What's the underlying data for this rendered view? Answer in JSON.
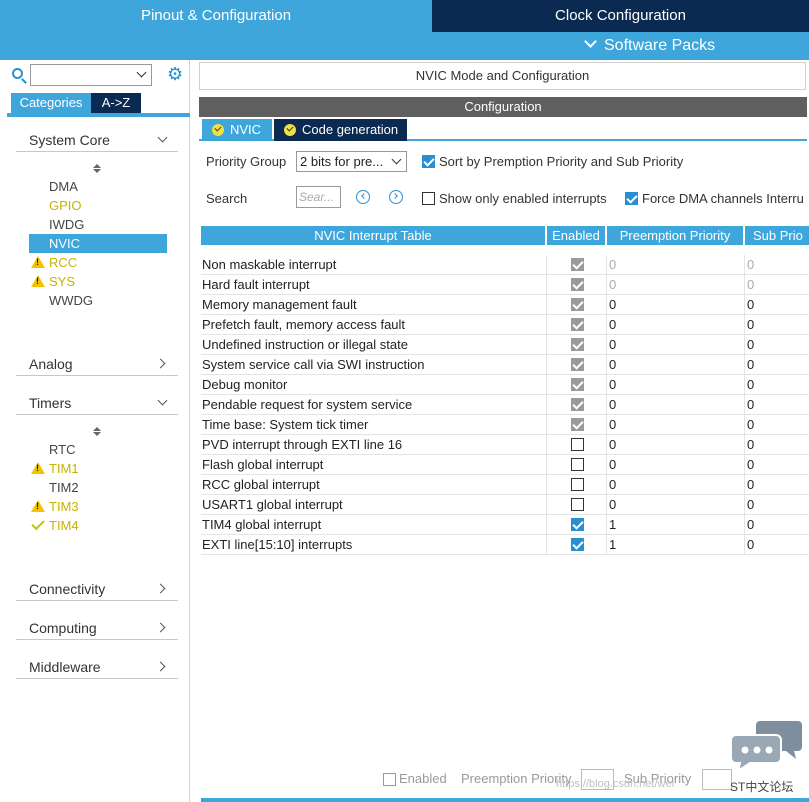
{
  "top_tabs": {
    "pinout": "Pinout & Configuration",
    "clock": "Clock Configuration",
    "software_packs": "Software Packs"
  },
  "left_panel": {
    "search_value": "",
    "tab_categories": "Categories",
    "tab_az": "A->Z",
    "system_core": {
      "title": "System Core",
      "items": [
        {
          "label": "DMA",
          "state": "normal"
        },
        {
          "label": "GPIO",
          "state": "configured"
        },
        {
          "label": "IWDG",
          "state": "normal"
        },
        {
          "label": "NVIC",
          "state": "selected"
        },
        {
          "label": "RCC",
          "state": "warning"
        },
        {
          "label": "SYS",
          "state": "warning"
        },
        {
          "label": "WWDG",
          "state": "normal"
        }
      ]
    },
    "analog": "Analog",
    "timers": {
      "title": "Timers",
      "items": [
        {
          "label": "RTC",
          "state": "normal"
        },
        {
          "label": "TIM1",
          "state": "warning"
        },
        {
          "label": "TIM2",
          "state": "normal"
        },
        {
          "label": "TIM3",
          "state": "warning"
        },
        {
          "label": "TIM4",
          "state": "ok"
        }
      ]
    },
    "connectivity": "Connectivity",
    "computing": "Computing",
    "middleware": "Middleware"
  },
  "main": {
    "mode_title": "NVIC Mode and Configuration",
    "config_title": "Configuration",
    "subtabs": {
      "nvic": "NVIC",
      "code": "Code generation"
    },
    "priority_group_label": "Priority Group",
    "priority_group_value": "2 bits for pre...",
    "sort_label": "Sort by Premption Priority and Sub Priority",
    "search_label": "Search",
    "search_placeholder": "Sear...",
    "show_enabled_label": "Show only enabled interrupts",
    "force_dma_label": "Force DMA channels Interru",
    "table": {
      "headers": [
        "NVIC Interrupt Table",
        "Enabled",
        "Preemption Priority",
        "Sub Prio"
      ],
      "rows": [
        {
          "name": "Non maskable interrupt",
          "enabled": true,
          "locked": true,
          "preemption": "0",
          "sub": "0",
          "dim": true
        },
        {
          "name": "Hard fault interrupt",
          "enabled": true,
          "locked": true,
          "preemption": "0",
          "sub": "0",
          "dim": true
        },
        {
          "name": "Memory management fault",
          "enabled": true,
          "locked": true,
          "preemption": "0",
          "sub": "0",
          "dim": false
        },
        {
          "name": "Prefetch fault, memory access fault",
          "enabled": true,
          "locked": true,
          "preemption": "0",
          "sub": "0",
          "dim": false
        },
        {
          "name": "Undefined instruction or illegal state",
          "enabled": true,
          "locked": true,
          "preemption": "0",
          "sub": "0",
          "dim": false
        },
        {
          "name": "System service call via SWI instruction",
          "enabled": true,
          "locked": true,
          "preemption": "0",
          "sub": "0",
          "dim": false
        },
        {
          "name": "Debug monitor",
          "enabled": true,
          "locked": true,
          "preemption": "0",
          "sub": "0",
          "dim": false
        },
        {
          "name": "Pendable request for system service",
          "enabled": true,
          "locked": true,
          "preemption": "0",
          "sub": "0",
          "dim": false
        },
        {
          "name": "Time base: System tick timer",
          "enabled": true,
          "locked": true,
          "preemption": "0",
          "sub": "0",
          "dim": false
        },
        {
          "name": "PVD interrupt through EXTI line 16",
          "enabled": false,
          "locked": false,
          "preemption": "0",
          "sub": "0",
          "dim": false
        },
        {
          "name": "Flash global interrupt",
          "enabled": false,
          "locked": false,
          "preemption": "0",
          "sub": "0",
          "dim": false
        },
        {
          "name": "RCC global interrupt",
          "enabled": false,
          "locked": false,
          "preemption": "0",
          "sub": "0",
          "dim": false
        },
        {
          "name": "USART1 global interrupt",
          "enabled": false,
          "locked": false,
          "preemption": "0",
          "sub": "0",
          "dim": false
        },
        {
          "name": "TIM4 global interrupt",
          "enabled": true,
          "locked": false,
          "preemption": "1",
          "sub": "0",
          "dim": false
        },
        {
          "name": "EXTI line[15:10] interrupts",
          "enabled": true,
          "locked": false,
          "preemption": "1",
          "sub": "0",
          "dim": false
        }
      ]
    },
    "bottom": {
      "enabled_label": "Enabled",
      "preemption_label": "Preemption Priority",
      "sub_label": "Sub Priority"
    },
    "watermark": "https://blog.csdn.net/wei",
    "forum": "ST中文论坛"
  },
  "colors": {
    "primary": "#3fa6dc",
    "dark": "#0b2a52",
    "warn": "#f2c300",
    "configured": "#c9b200"
  },
  "icons": {
    "search": "search-icon",
    "gear": "gear-icon",
    "chat": "chat-icon"
  }
}
